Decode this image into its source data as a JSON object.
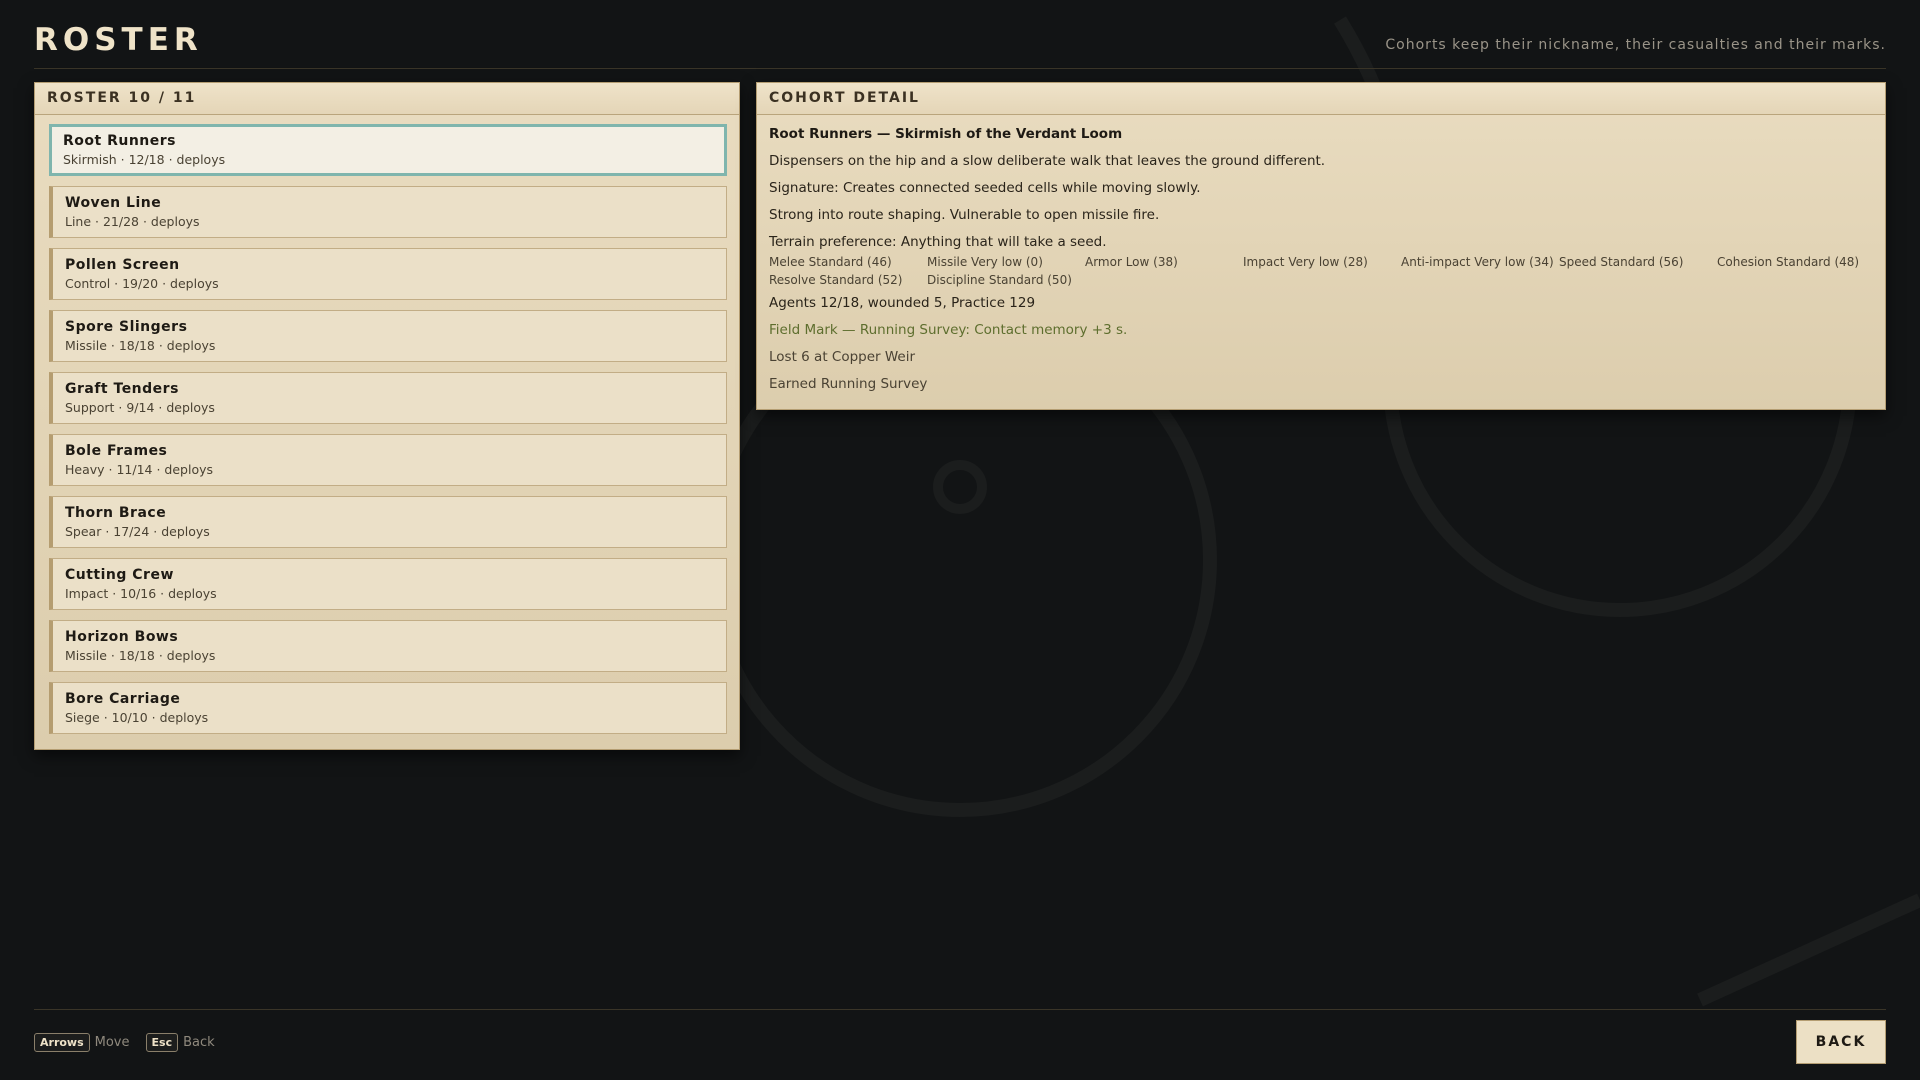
{
  "header": {
    "title": "ROSTER",
    "tagline": "Cohorts keep their nickname, their casualties and their marks."
  },
  "roster": {
    "heading": "ROSTER 10 / 11",
    "selected_index": 0,
    "items": [
      {
        "name": "Root Runners",
        "sub": "Skirmish · 12/18 · deploys"
      },
      {
        "name": "Woven Line",
        "sub": "Line · 21/28 · deploys"
      },
      {
        "name": "Pollen Screen",
        "sub": "Control · 19/20 · deploys"
      },
      {
        "name": "Spore Slingers",
        "sub": "Missile · 18/18 · deploys"
      },
      {
        "name": "Graft Tenders",
        "sub": "Support · 9/14 · deploys"
      },
      {
        "name": "Bole Frames",
        "sub": "Heavy · 11/14 · deploys"
      },
      {
        "name": "Thorn Brace",
        "sub": "Spear · 17/24 · deploys"
      },
      {
        "name": "Cutting Crew",
        "sub": "Impact · 10/16 · deploys"
      },
      {
        "name": "Horizon Bows",
        "sub": "Missile · 18/18 · deploys"
      },
      {
        "name": "Bore Carriage",
        "sub": "Siege · 10/10 · deploys"
      }
    ]
  },
  "detail": {
    "heading": "COHORT DETAIL",
    "title": "Root Runners — Skirmish of the Verdant Loom",
    "description": "Dispensers on the hip and a slow deliberate walk that leaves the ground different.",
    "signature": "Signature: Creates connected seeded cells while moving slowly.",
    "strengths": "Strong into route shaping. Vulnerable to open missile fire.",
    "terrain": "Terrain preference: Anything that will take a seed.",
    "stats": [
      "Melee Standard (46)",
      "Missile Very low (0)",
      "Armor Low (38)",
      "Impact Very low (28)",
      "Anti-impact Very low (34)",
      "Speed Standard (56)",
      "Cohesion Standard (48)",
      "Resolve Standard (52)",
      "Discipline Standard (50)"
    ],
    "agents": "Agents 12/18, wounded 5, Practice 129",
    "field_mark": "Field Mark — Running Survey: Contact memory +3 s.",
    "history": [
      "Lost 6 at Copper Weir",
      "Earned Running Survey"
    ]
  },
  "footer": {
    "keys": [
      {
        "key": "Arrows",
        "label": "Move"
      },
      {
        "key": "Esc",
        "label": "Back"
      }
    ],
    "back_label": "BACK"
  },
  "colors": {
    "background": "#121415",
    "panel": "#e4d6b8",
    "selected_border": "#7fb5ad",
    "field_mark": "#5e6e2e",
    "title": "#efe3c8"
  }
}
